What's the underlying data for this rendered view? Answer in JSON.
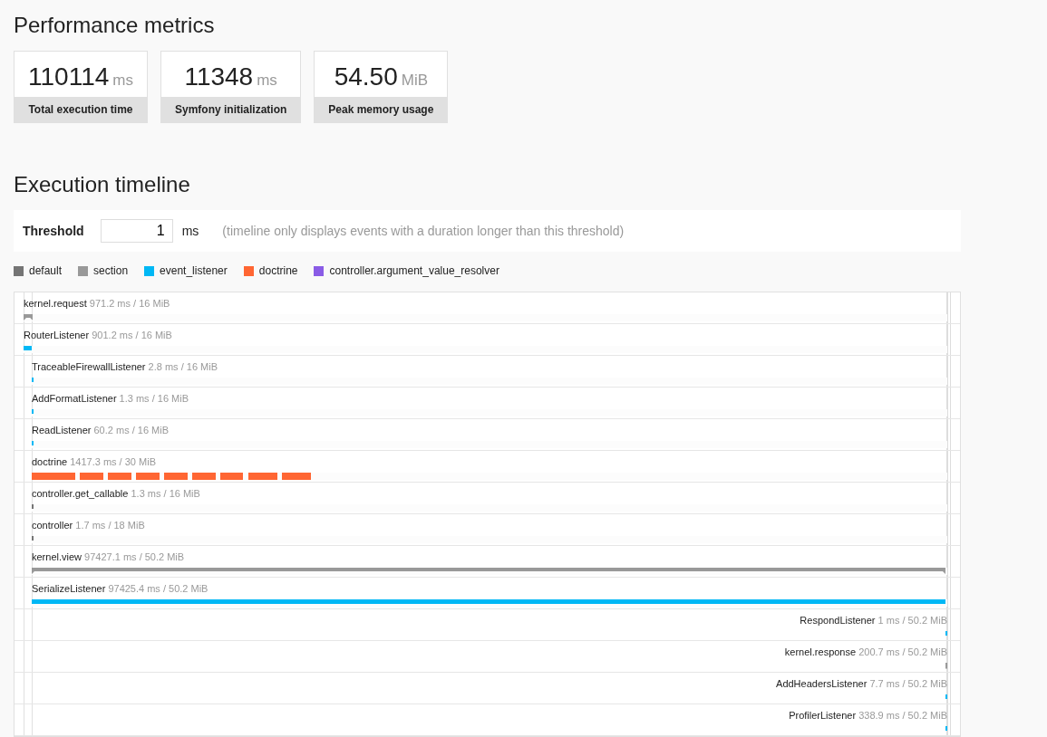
{
  "metrics_title": "Performance metrics",
  "metrics": [
    {
      "value": "110114",
      "unit": "ms",
      "label": "Total execution time"
    },
    {
      "value": "11348",
      "unit": "ms",
      "label": "Symfony initialization"
    },
    {
      "value": "54.50",
      "unit": "MiB",
      "label": "Peak memory usage"
    }
  ],
  "timeline_title": "Execution timeline",
  "threshold": {
    "label": "Threshold",
    "value": "1",
    "unit": "ms",
    "hint": "(timeline only displays events with a duration longer than this threshold)"
  },
  "legend": [
    {
      "label": "default",
      "color": "#757575"
    },
    {
      "label": "section",
      "color": "#999999"
    },
    {
      "label": "event_listener",
      "color": "#00b8f5"
    },
    {
      "label": "doctrine",
      "color": "#ff6633"
    },
    {
      "label": "controller.argument_value_resolver",
      "color": "#8a5ce6"
    }
  ],
  "events": [
    {
      "name": "kernel.request",
      "detail": "971.2 ms / 16 MiB",
      "kind": "section",
      "color": "#999999",
      "level": 0.01
    },
    {
      "name": "RouterListener",
      "detail": "901.2 ms / 16 MiB",
      "kind": "bar",
      "color": "#00b8f5",
      "level": 0.009,
      "children": [
        {
          "name": "TraceableFirewallListener",
          "detail": "2.8 ms / 16 MiB",
          "kind": "bar",
          "color": "#00b8f5",
          "level": 0.002
        },
        {
          "name": "AddFormatListener",
          "detail": "1.3 ms / 16 MiB",
          "kind": "bar",
          "color": "#00b8f5",
          "level": 0.002
        },
        {
          "name": "ReadListener",
          "detail": "60.2 ms / 16 MiB",
          "kind": "bar",
          "color": "#00b8f5",
          "level": 0.002
        },
        {
          "name": "doctrine",
          "detail": "1417.3 ms / 30 MiB",
          "kind": "segmented",
          "color": "#ff6633",
          "level": 0.305
        },
        {
          "name": "controller.get_callable",
          "detail": "1.3 ms / 16 MiB",
          "kind": "bar",
          "color": "#757575",
          "level": 0.002
        },
        {
          "name": "controller",
          "detail": "1.7 ms / 18 MiB",
          "kind": "bar",
          "color": "#757575",
          "level": 0.002
        },
        {
          "name": "kernel.view",
          "detail": "97427.1 ms / 50.2 MiB",
          "kind": "section",
          "color": "#999999",
          "level": 0.998
        },
        {
          "name": "SerializeListener",
          "detail": "97425.4 ms / 50.2 MiB",
          "kind": "bar",
          "color": "#00b8f5",
          "level": 0.998
        },
        {
          "name": "RespondListener",
          "detail": "1 ms / 50.2 MiB",
          "kind": "end_bar",
          "color": "#00b8f5"
        },
        {
          "name": "kernel.response",
          "detail": "200.7 ms / 50.2 MiB",
          "kind": "end_section",
          "color": "#999999"
        },
        {
          "name": "AddHeadersListener",
          "detail": "7.7 ms / 50.2 MiB",
          "kind": "end_bar",
          "color": "#00b8f5"
        },
        {
          "name": "ProfilerListener",
          "detail": "338.9 ms / 50.2 MiB",
          "kind": "end_bar",
          "color": "#00b8f5"
        }
      ]
    }
  ]
}
